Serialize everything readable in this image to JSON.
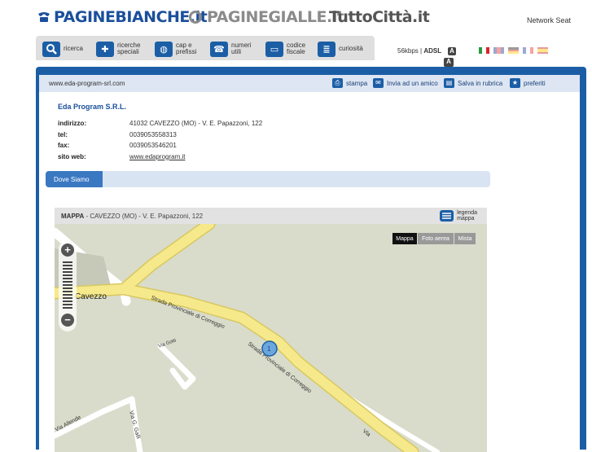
{
  "brands": {
    "paginebianche": "PAGINEBIANCHE.it",
    "paginegialle": "PAGINEGIALLE.it",
    "tuttocitta": "TuttoCittà.it",
    "network": "Network Seat"
  },
  "toolbar": {
    "items": [
      {
        "label": "ricerca",
        "icon": "search-icon"
      },
      {
        "label": "ricerche\nspeciali",
        "icon": "puzzle-icon"
      },
      {
        "label": "cap e\nprefissi",
        "icon": "globe-icon"
      },
      {
        "label": "numeri\nutili",
        "icon": "phone-icon"
      },
      {
        "label": "codice\nfiscale",
        "icon": "card-icon"
      },
      {
        "label": "curiosità",
        "icon": "info-icon"
      }
    ],
    "connection": "56kbps",
    "connection_alt": "ADSL",
    "font_small": "A",
    "font_large": "A"
  },
  "urlbar": {
    "url": "www.eda-program-srl.com",
    "actions": [
      "stampa",
      "Invia ad un amico",
      "Salva in rubrica",
      "preferiti"
    ]
  },
  "company": {
    "name": "Eda Program S.R.L.",
    "fields": [
      {
        "key": "indirizzo:",
        "value": "41032 CAVEZZO (MO) - V. E. Papazzoni, 122"
      },
      {
        "key": "tel:",
        "value": "0039053558313"
      },
      {
        "key": "fax:",
        "value": "0039053546201"
      },
      {
        "key": "sito web:",
        "value": "www.edaprogram.it"
      }
    ]
  },
  "tabs": {
    "active": "Dove Siamo"
  },
  "map": {
    "title": "MAPPA",
    "address": "CAVEZZO (MO) - V. E. Papazzoni, 122",
    "legend": "legenda\nmappa",
    "types": [
      "Mappa",
      "Foto aerea",
      "Mista"
    ],
    "active_type": "Mappa",
    "marker": "1",
    "labels": {
      "town": "Cavezzo",
      "road1": "Strada Provinciale di Correggio",
      "road2": "Strada Provinciale di Correggio",
      "via_gotti": "Via Gotti",
      "via_allende": "Via Allende",
      "via_galli": "Via G. Galli",
      "via_bottom": "Via"
    }
  },
  "colors": {
    "brand_blue": "#1b5ea6",
    "map_bg": "#d9dccb",
    "road_yellow": "#f6e98c"
  }
}
